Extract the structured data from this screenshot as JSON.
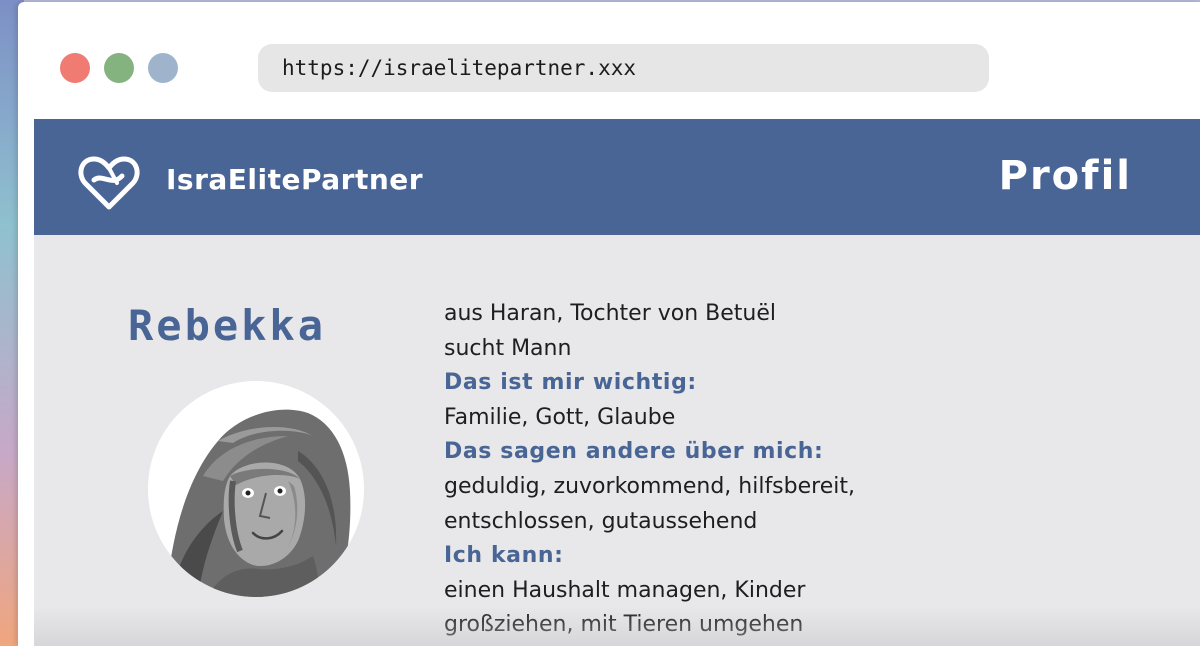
{
  "browser": {
    "url": "https://israelitepartner.xxx",
    "traffic_lights": [
      {
        "name": "close",
        "color": "#ef7b72"
      },
      {
        "name": "minimize",
        "color": "#85b37f"
      },
      {
        "name": "maximize",
        "color": "#9fb4cc"
      }
    ]
  },
  "header": {
    "brand": "IsraElitePartner",
    "logo_icon": "heart-icon",
    "page_title": "Profil",
    "color": "#496595"
  },
  "profile": {
    "name": "Rebekka",
    "avatar_icon": "woman-portrait",
    "lines": [
      {
        "text": "aus Haran, Tochter von Betuël",
        "kind": "value"
      },
      {
        "text": "sucht Mann",
        "kind": "value"
      },
      {
        "text": "Das ist mir wichtig:",
        "kind": "label"
      },
      {
        "text": "Familie, Gott, Glaube",
        "kind": "value"
      },
      {
        "text": "Das sagen andere über mich:",
        "kind": "label"
      },
      {
        "text": "geduldig, zuvorkommend, hilfsbereit,",
        "kind": "value"
      },
      {
        "text": "entschlossen, gutaussehend",
        "kind": "value"
      },
      {
        "text": "Ich kann:",
        "kind": "label"
      },
      {
        "text": "einen Haushalt managen, Kinder",
        "kind": "value"
      },
      {
        "text": "großziehen, mit Tieren umgehen",
        "kind": "value"
      }
    ]
  }
}
